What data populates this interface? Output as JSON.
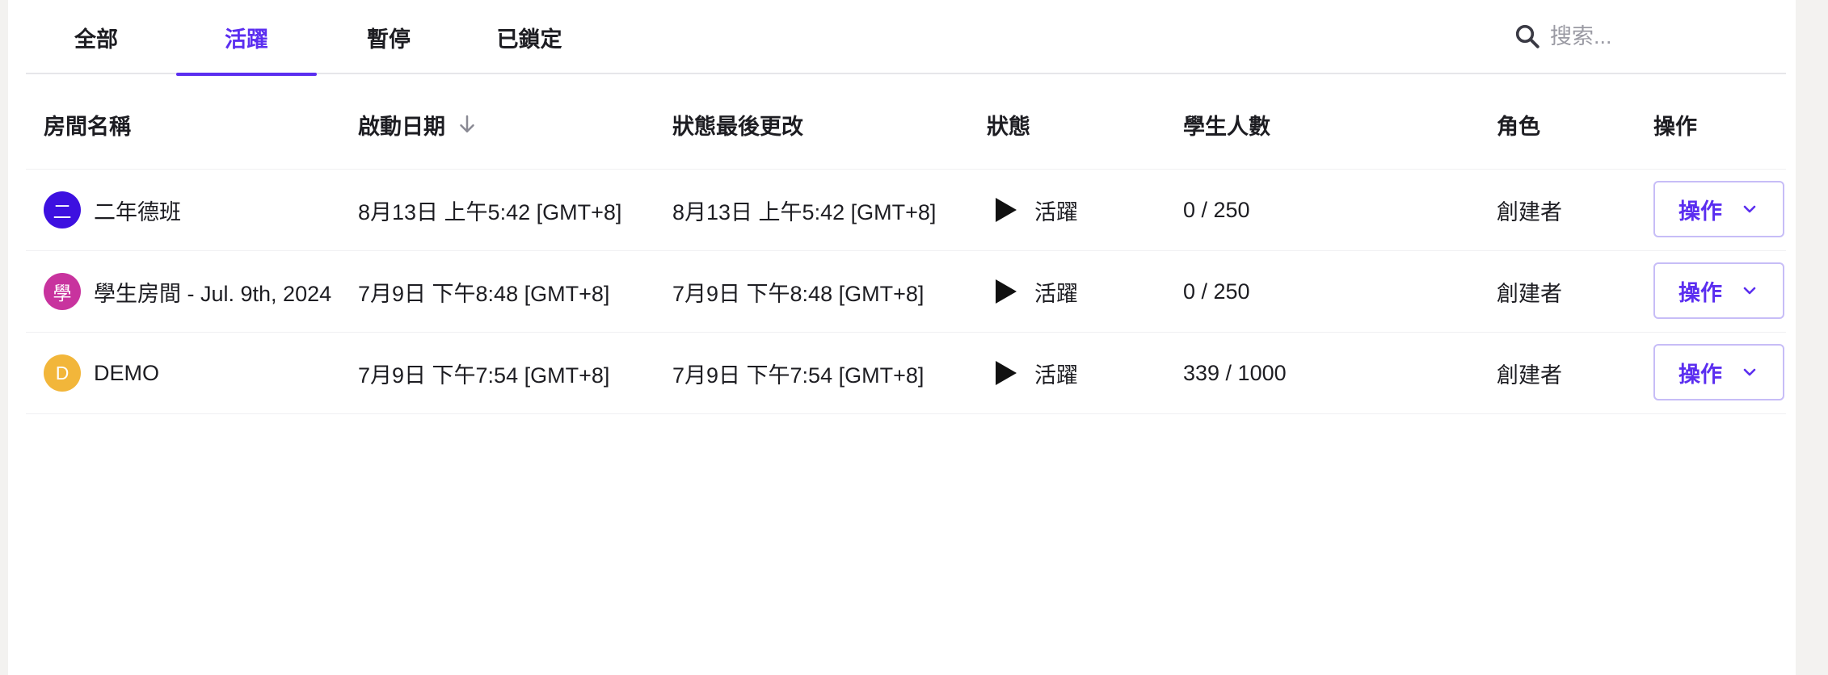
{
  "tabs": [
    {
      "label": "全部",
      "active": false
    },
    {
      "label": "活躍",
      "active": true
    },
    {
      "label": "暫停",
      "active": false
    },
    {
      "label": "已鎖定",
      "active": false
    }
  ],
  "search": {
    "placeholder": "搜索...",
    "value": "",
    "icon": "search-icon"
  },
  "table": {
    "headers": {
      "name": "房間名稱",
      "start_date": "啟動日期",
      "status_changed": "狀態最後更改",
      "status": "狀態",
      "students": "學生人數",
      "role": "角色",
      "actions": "操作"
    },
    "sort_icon": "arrow-down-icon",
    "rows": [
      {
        "avatar_letter": "二",
        "avatar_color": "#3d10e0",
        "name": "二年德班",
        "start_date": "8月13日 上午5:42 [GMT+8]",
        "status_changed": "8月13日 上午5:42 [GMT+8]",
        "status": "活躍",
        "students": "0 / 250",
        "role": "創建者",
        "action_label": "操作"
      },
      {
        "avatar_letter": "學",
        "avatar_color": "#c8339e",
        "name": "學生房間 - Jul. 9th, 2024",
        "start_date": "7月9日 下午8:48 [GMT+8]",
        "status_changed": "7月9日 下午8:48 [GMT+8]",
        "status": "活躍",
        "students": "0 / 250",
        "role": "創建者",
        "action_label": "操作"
      },
      {
        "avatar_letter": "D",
        "avatar_color": "#f2b63a",
        "name": "DEMO",
        "start_date": "7月9日 下午7:54 [GMT+8]",
        "status_changed": "7月9日 下午7:54 [GMT+8]",
        "status": "活躍",
        "students": "339 / 1000",
        "role": "創建者",
        "action_label": "操作"
      }
    ]
  },
  "colors": {
    "accent": "#5b2ef0",
    "background": "#f3f2f0",
    "panel": "#ffffff"
  }
}
